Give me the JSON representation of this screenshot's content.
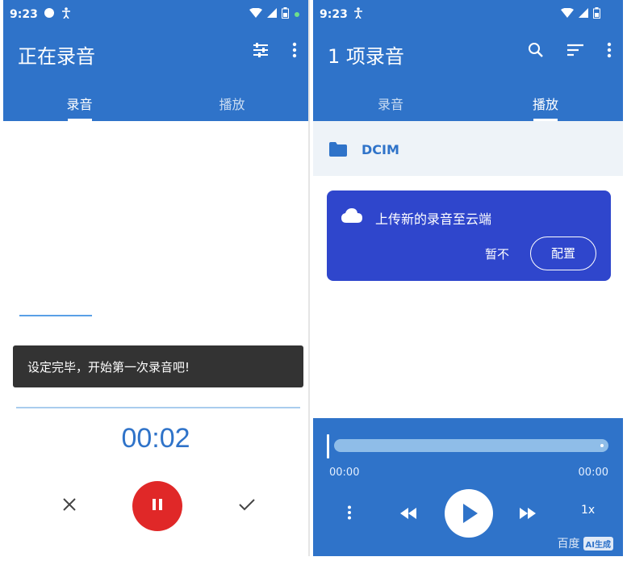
{
  "left": {
    "status": {
      "time": "9:23"
    },
    "title": "正在录音",
    "tabs": [
      {
        "label": "录音"
      },
      {
        "label": "播放"
      }
    ],
    "toast": "设定完毕，开始第一次录音吧!",
    "timer": "00:02"
  },
  "right": {
    "status": {
      "time": "9:23"
    },
    "title": "1 项录音",
    "tabs": [
      {
        "label": "录音"
      },
      {
        "label": "播放"
      }
    ],
    "folder": {
      "label": "DCIM"
    },
    "upload_card": {
      "message": "上传新的录音至云端",
      "not_now": "暂不",
      "configure": "配置"
    },
    "player": {
      "elapsed": "00:00",
      "duration": "00:00",
      "speed": "1x",
      "progress": 0
    }
  },
  "watermark": {
    "text": "百度",
    "badge": "AI生成"
  },
  "colors": {
    "primary": "#2f73c9",
    "record": "#e02828",
    "card": "#2f46cc",
    "toast": "#333333"
  }
}
